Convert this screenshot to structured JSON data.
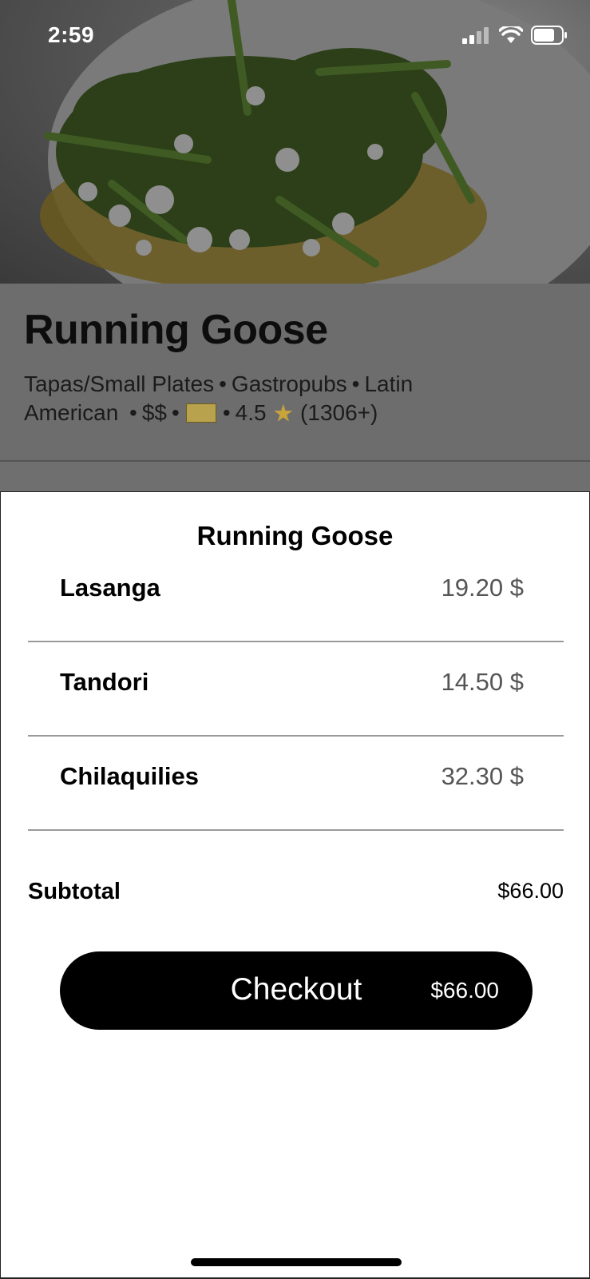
{
  "status_bar": {
    "time": "2:59",
    "icons": [
      "signal-icon",
      "wifi-icon",
      "battery-icon"
    ]
  },
  "restaurant": {
    "name": "Running Goose",
    "categories": [
      "Tapas/Small Plates",
      "Gastropubs",
      "Latin American"
    ],
    "price_level": "$$",
    "badge_icon": "certificate-badge-icon",
    "rating": "4.5",
    "rating_icon": "star-icon",
    "review_count": "(1306+)"
  },
  "sheet": {
    "title": "Running Goose",
    "items": [
      {
        "name": "Lasanga",
        "price": "19.20 $"
      },
      {
        "name": "Tandori",
        "price": "14.50 $"
      },
      {
        "name": "Chilaquilies",
        "price": "32.30 $"
      }
    ],
    "subtotal_label": "Subtotal",
    "subtotal_value": "$66.00",
    "checkout_label": "Checkout",
    "checkout_amount": "$66.00"
  },
  "colors": {
    "overlay_dim": "#6d6d6d",
    "sheet_background": "#ffffff",
    "button_background": "#000000",
    "price_text": "#555555"
  }
}
